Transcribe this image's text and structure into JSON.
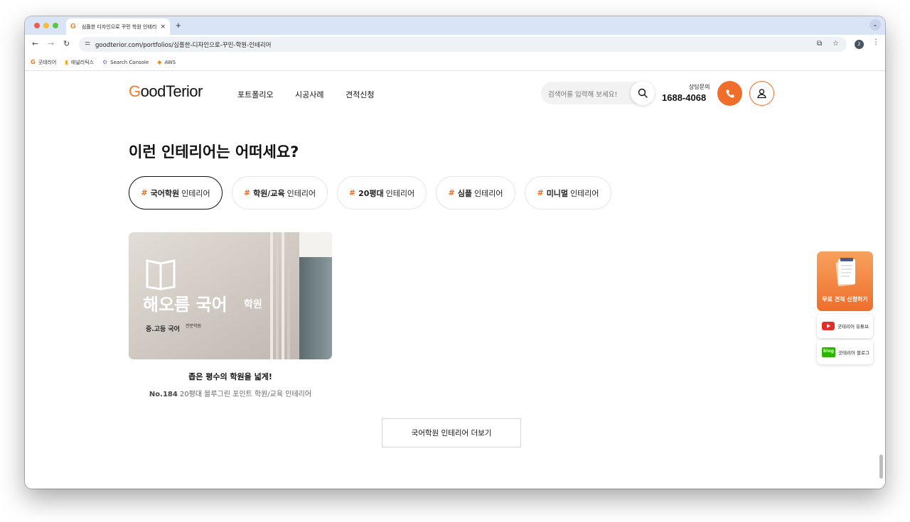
{
  "browser": {
    "tab_title": "심플한 디자인으로 꾸민 학원 인테리어",
    "tab_favicon": "G",
    "tab_close": "×",
    "new_tab": "+",
    "tab_menu": "⌄",
    "url": "goodterior.com/portfolios/심플한-디자인으로-꾸민-학원-인테리어",
    "profile_badge": "2",
    "nav_back": "←",
    "nav_forward": "→",
    "nav_reload": "↻",
    "menu": "⋮"
  },
  "bookmarks": [
    {
      "icon": "G",
      "label": "굿테리어"
    },
    {
      "icon": "▮",
      "label": "애널리틱스"
    },
    {
      "icon": "⚙",
      "label": "Search Console"
    },
    {
      "icon": "◆",
      "label": "AWS"
    }
  ],
  "site": {
    "logo_g": "G",
    "logo_rest": "oodTerior",
    "nav": [
      "포트폴리오",
      "시공사례",
      "견적신청"
    ],
    "search_placeholder": "검색어를 입력해 보세요!",
    "consult_label": "상담문의",
    "consult_phone": "1688-4068"
  },
  "section": {
    "title": "이런 인테리어는 어떠세요?",
    "chips": [
      {
        "hash": "#",
        "keyword": "국어학원",
        "suffix": "인테리어",
        "active": true
      },
      {
        "hash": "#",
        "keyword": "학원/교육",
        "suffix": "인테리어",
        "active": false
      },
      {
        "hash": "#",
        "keyword": "20평대",
        "suffix": "인테리어",
        "active": false
      },
      {
        "hash": "#",
        "keyword": "심플",
        "suffix": "인테리어",
        "active": false
      },
      {
        "hash": "#",
        "keyword": "미니멀",
        "suffix": "인테리어",
        "active": false
      }
    ]
  },
  "card": {
    "sign_main": "해오름 국어",
    "sign_small": "학원",
    "sign_sub": "중.고등 국어",
    "sign_sub2": "전문학원",
    "title": "좁은 평수의 학원을 넓게!",
    "number": "No.184",
    "subtitle": "20평대 블루그린 포인트 학원/교육 인테리어"
  },
  "more_button": "국어학원 인테리어 더보기",
  "floating": {
    "cta": "무료 견적 신청하기",
    "youtube": "굿테리어 유튜브",
    "blog_badge": "blog",
    "blog": "굿테리어 블로그"
  },
  "colors": {
    "accent": "#ef6e2b",
    "tabstrip": "#d9e4f7",
    "youtube": "#e52d27",
    "blog": "#2db400"
  }
}
